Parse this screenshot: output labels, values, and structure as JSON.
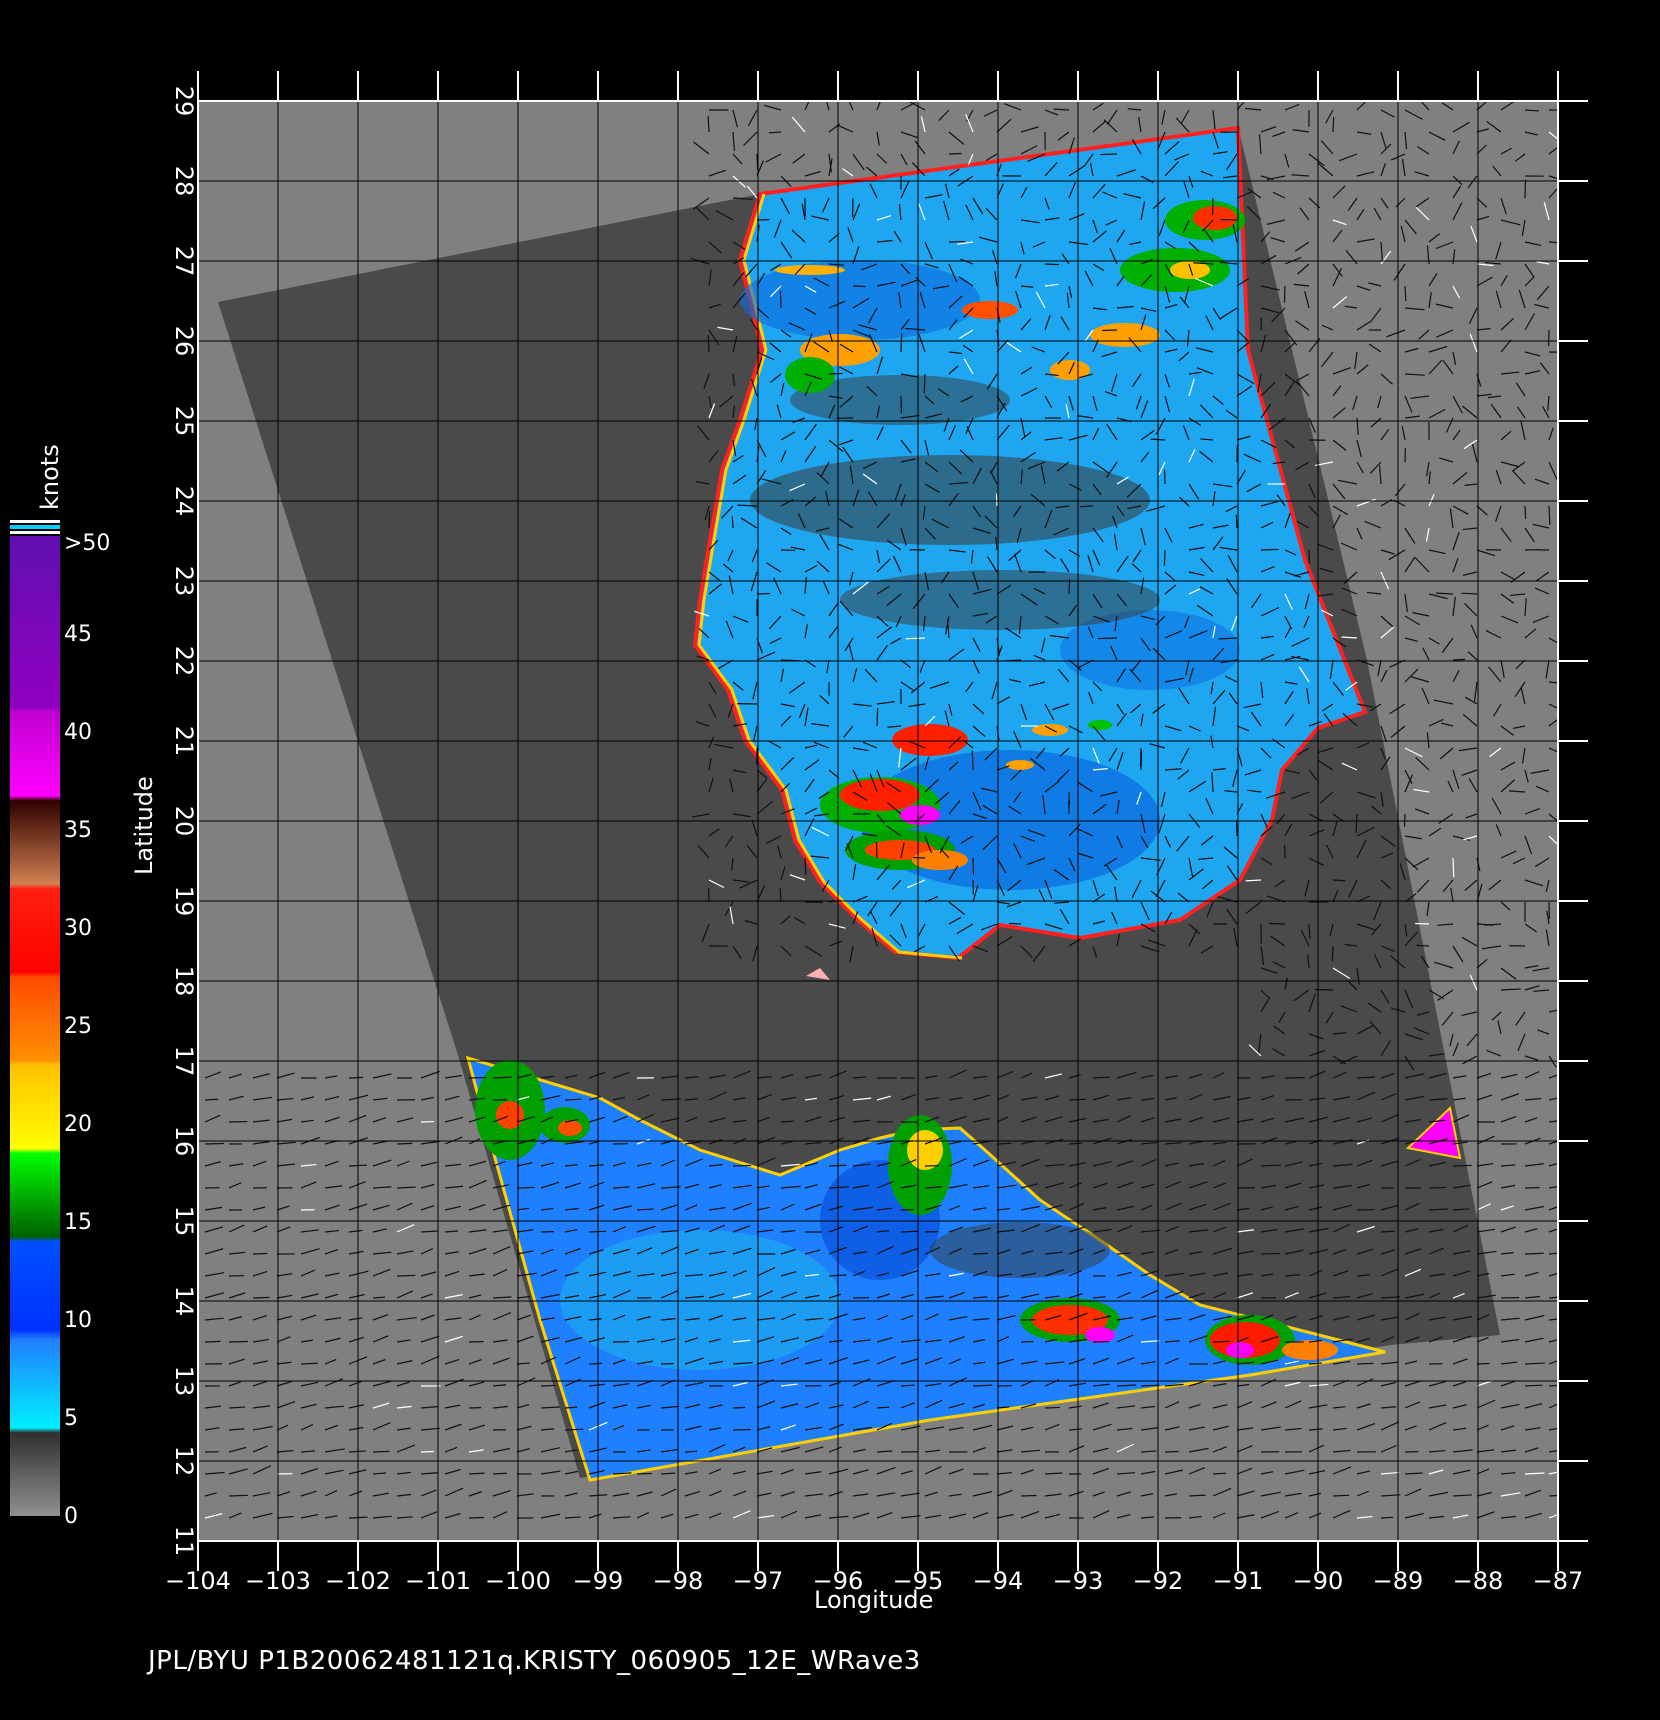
{
  "map": {
    "xlabel": "Longitude",
    "ylabel": "Latitude",
    "lon_range": [
      -104,
      -87
    ],
    "lat_range": [
      11,
      29
    ],
    "lon_ticks": [
      "−104",
      "−103",
      "−102",
      "−101",
      "−100",
      "−99",
      "−98",
      "−97",
      "−96",
      "−95",
      "−94",
      "−93",
      "−92",
      "−91",
      "−90",
      "−89",
      "−88",
      "−87"
    ],
    "lat_ticks": [
      "11",
      "12",
      "13",
      "14",
      "15",
      "16",
      "17",
      "18",
      "19",
      "20",
      "21",
      "22",
      "23",
      "24",
      "25",
      "26",
      "27",
      "28",
      "29"
    ],
    "grid": true,
    "background_color": "#808080",
    "swath_nodata_color": "#4a4a4a",
    "wind_barbs": true
  },
  "colorbar": {
    "unit": "knots",
    "labels": [
      "0",
      "5",
      "10",
      "15",
      "20",
      "25",
      "30",
      "35",
      "40",
      "45",
      ">50"
    ],
    "bands": [
      {
        "from": 0,
        "to": 5,
        "color": "#555555"
      },
      {
        "from": 5,
        "to": 10,
        "color": "#1fa8ff"
      },
      {
        "from": 10,
        "to": 15,
        "color": "#0050ff"
      },
      {
        "from": 15,
        "to": 20,
        "color": "#00c000"
      },
      {
        "from": 20,
        "to": 25,
        "color": "#ffe000"
      },
      {
        "from": 25,
        "to": 30,
        "color": "#ff7a00"
      },
      {
        "from": 30,
        "to": 35,
        "color": "#ff1a00"
      },
      {
        "from": 35,
        "to": 40,
        "color": "#7a3a20"
      },
      {
        "from": 40,
        "to": 45,
        "color": "#ff00ff"
      },
      {
        "from": 45,
        "to": 50,
        "color": "#8000d0"
      }
    ]
  },
  "footer": {
    "credit": "JPL/BYU",
    "filename": "P1B20062481121q.KRISTY_060905_12E_WRave3"
  }
}
